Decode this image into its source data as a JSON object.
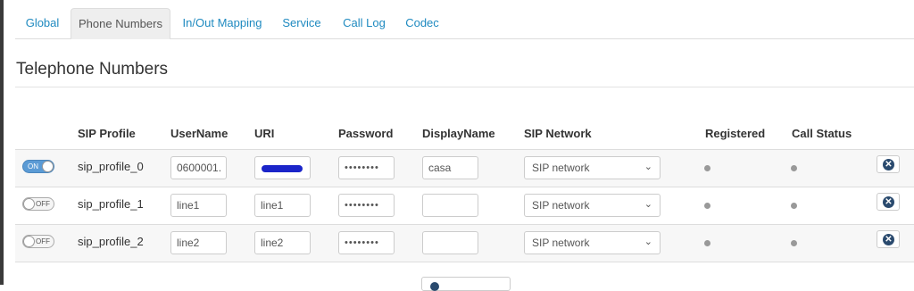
{
  "tabs": [
    {
      "label": "Global"
    },
    {
      "label": "Phone Numbers"
    },
    {
      "label": "In/Out Mapping"
    },
    {
      "label": "Service"
    },
    {
      "label": "Call Log"
    },
    {
      "label": "Codec"
    }
  ],
  "active_tab": "Phone Numbers",
  "page_title": "Telephone Numbers",
  "table": {
    "headers": [
      "SIP Profile",
      "UserName",
      "URI",
      "Password",
      "DisplayName",
      "SIP Network",
      "Registered",
      "Call Status"
    ],
    "rows": [
      {
        "enabled": "ON",
        "profile": "sip_profile_0",
        "username": "0600001.",
        "uri": "",
        "password": "••••••••",
        "display_name": "casa",
        "sip_network": "SIP network"
      },
      {
        "enabled": "OFF",
        "profile": "sip_profile_1",
        "username": "line1",
        "uri": "line1",
        "password": "••••••••",
        "display_name": "",
        "sip_network": "SIP network"
      },
      {
        "enabled": "OFF",
        "profile": "sip_profile_2",
        "username": "line2",
        "uri": "line2",
        "password": "••••••••",
        "display_name": "",
        "sip_network": "SIP network"
      }
    ]
  },
  "icons": {
    "delete": "remove-circle-icon",
    "status": "status-dot-icon",
    "select": "chevron-down-icon"
  },
  "colors": {
    "link": "#1f8ac0",
    "toggle_on": "#5b9bd5",
    "status_dot": "#999999",
    "delete_icon": "#2a4a6e"
  }
}
